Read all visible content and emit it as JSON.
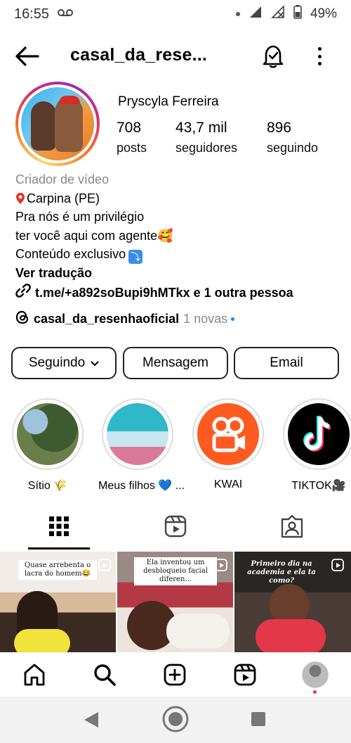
{
  "status_bar": {
    "time": "16:55",
    "battery": "49%"
  },
  "header": {
    "username": "casal_da_rese..."
  },
  "profile": {
    "name": "Pryscyla Ferreira",
    "stats": [
      {
        "value": "708",
        "label": "posts"
      },
      {
        "value": "43,7 mil",
        "label": "seguidores"
      },
      {
        "value": "896",
        "label": "seguindo"
      }
    ],
    "category": "Criador de vídeo",
    "bio_lines": [
      "Carpina (PE)",
      "Pra nós é um privilégio",
      "ter você aqui com agente🥰",
      "Conteúdo exclusivo"
    ],
    "translate": "Ver tradução",
    "link": "t.me/+a892soBupi9hMTkx e 1 outra pessoa",
    "threads_handle": "casal_da_resenhaoficial",
    "threads_badge": "1 novas"
  },
  "actions": {
    "following": "Seguindo",
    "message": "Mensagem",
    "email": "Email"
  },
  "highlights": [
    {
      "label": "Sítio 🌾"
    },
    {
      "label": "Meus filhos 💙 ..."
    },
    {
      "label": "KWAI"
    },
    {
      "label": "TIKTOK🎥"
    }
  ],
  "posts": [
    {
      "caption": "Quase arrebenta o lacra do homem😂"
    },
    {
      "caption": "Ela inventou um desbloqueio facial diferen..."
    },
    {
      "caption": "Primeiro dia na academia e ela ta como?"
    }
  ],
  "colors": {
    "accent": "#0095f6",
    "kwai": "#ff5a1f",
    "tiktok_bg": "#000000",
    "notification": "#ff3040"
  }
}
